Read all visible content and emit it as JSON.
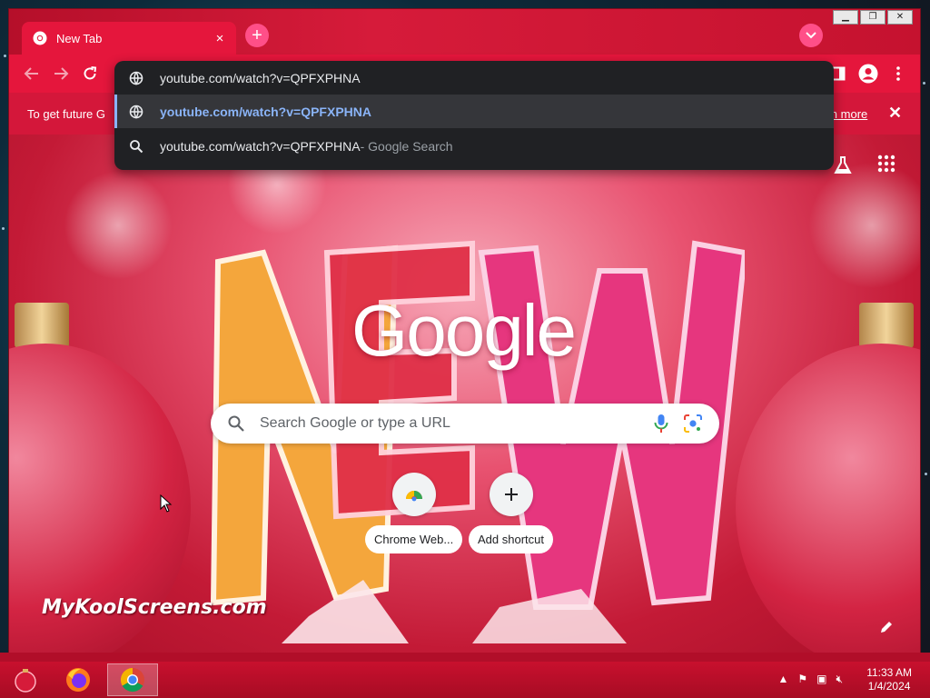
{
  "browser": {
    "tab_title": "New Tab",
    "tab_close_glyph": "×",
    "new_tab_glyph": "+",
    "window_controls": [
      "▁",
      "❐",
      "✕"
    ]
  },
  "toolbar": {
    "back_icon": "arrow-left-icon",
    "forward_icon": "arrow-right-icon",
    "reload_icon": "reload-icon"
  },
  "infobar": {
    "text": "To get future G",
    "link": "earn more",
    "close": "✕"
  },
  "omnibox": {
    "input_value": "youtube.com/watch?v=QPFXPHNA",
    "suggestions": [
      {
        "text": "youtube.com/watch?v=QPFXPHNA",
        "suffix": "",
        "icon": "globe-icon"
      },
      {
        "text": "youtube.com/watch?v=QPFXPHNA",
        "suffix": " - Google Search",
        "icon": "search-icon"
      }
    ]
  },
  "ntp": {
    "logo": "Google",
    "search_placeholder": "Search Google or type a URL",
    "shortcuts": [
      {
        "label": "Chrome Web...",
        "icon": "chrome-web-store-icon"
      },
      {
        "label": "Add shortcut",
        "icon": "plus-icon"
      }
    ],
    "watermark": "MyKoolScreens.com"
  },
  "taskbar": {
    "apps": [
      "ornament-icon",
      "firefox-icon",
      "chrome-icon"
    ],
    "time": "11:33 AM",
    "date": "1/4/2024"
  },
  "colors": {
    "theme_red": "#e5163c",
    "omnibox_bg": "#202124",
    "suggestion_blue": "#8ab4f8"
  }
}
